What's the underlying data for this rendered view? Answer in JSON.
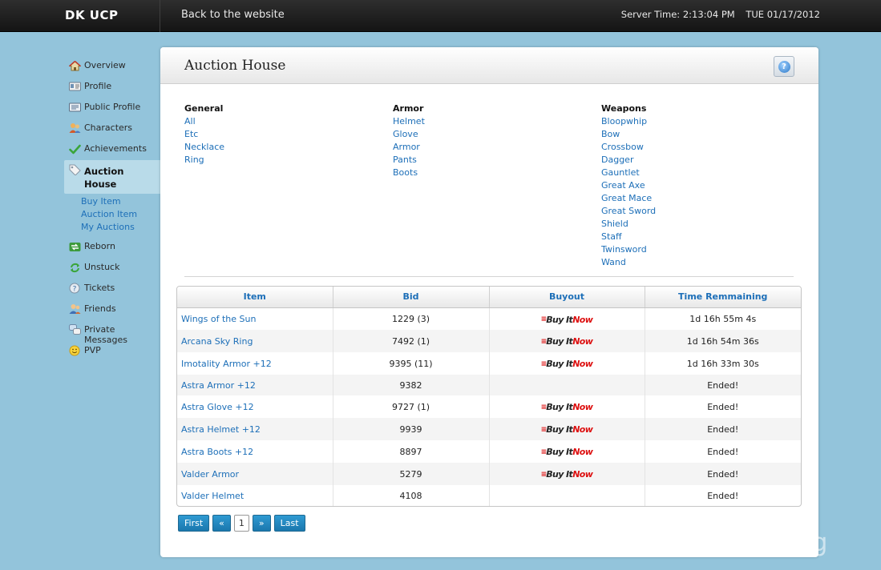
{
  "topbar": {
    "brand": "DK UCP",
    "back_link": "Back to the website",
    "server_time": "Server Time: 2:13:04 PM",
    "date": "TUE 01/17/2012"
  },
  "sidebar": {
    "items": [
      {
        "label": "Overview",
        "icon": "house-icon"
      },
      {
        "label": "Profile",
        "icon": "id-card-icon"
      },
      {
        "label": "Public Profile",
        "icon": "id-card-icon"
      },
      {
        "label": "Characters",
        "icon": "characters-icon"
      },
      {
        "label": "Achievements",
        "icon": "checkmark-icon"
      },
      {
        "label": "Auction House",
        "icon": "tag-icon"
      },
      {
        "label": "Reborn",
        "icon": "arrows-icon"
      },
      {
        "label": "Unstuck",
        "icon": "recycle-icon"
      },
      {
        "label": "Tickets",
        "icon": "help-circle-icon"
      },
      {
        "label": "Friends",
        "icon": "friends-icon"
      },
      {
        "label": "Private Messages",
        "icon": "chat-bubbles-icon"
      },
      {
        "label": "PVP",
        "icon": "smiley-icon"
      }
    ],
    "sub_items": [
      "Buy Item",
      "Auction Item",
      "My Auctions"
    ]
  },
  "panel": {
    "title": "Auction House",
    "help_label": "?"
  },
  "categories": {
    "general": {
      "heading": "General",
      "links": [
        "All",
        "Etc",
        "Necklace",
        "Ring"
      ]
    },
    "armor": {
      "heading": "Armor",
      "links": [
        "Helmet",
        "Glove",
        "Armor",
        "Pants",
        "Boots"
      ]
    },
    "weapons": {
      "heading": "Weapons",
      "links": [
        "Bloopwhip",
        "Bow",
        "Crossbow",
        "Dagger",
        "Gauntlet",
        "Great Axe",
        "Great Mace",
        "Great Sword",
        "Shield",
        "Staff",
        "Twinsword",
        "Wand"
      ]
    }
  },
  "table": {
    "headers": [
      "Item",
      "Bid",
      "Buyout",
      "Time Remmaining"
    ],
    "buy_now_part1": "Buy It",
    "buy_now_part2": "Now",
    "rows": [
      {
        "item": "Wings of the Sun",
        "bid": "1229 (3)",
        "buyout": true,
        "time": "1d 16h 55m 4s"
      },
      {
        "item": "Arcana Sky Ring",
        "bid": "7492 (1)",
        "buyout": true,
        "time": "1d 16h 54m 36s"
      },
      {
        "item": "Imotality Armor +12",
        "bid": "9395 (11)",
        "buyout": true,
        "time": "1d 16h 33m 30s"
      },
      {
        "item": "Astra Armor +12",
        "bid": "9382",
        "buyout": false,
        "time": "Ended!"
      },
      {
        "item": "Astra Glove +12",
        "bid": "9727 (1)",
        "buyout": true,
        "time": "Ended!"
      },
      {
        "item": "Astra Helmet +12",
        "bid": "9939",
        "buyout": true,
        "time": "Ended!"
      },
      {
        "item": "Astra Boots +12",
        "bid": "8897",
        "buyout": true,
        "time": "Ended!"
      },
      {
        "item": "Valder Armor",
        "bid": "5279",
        "buyout": true,
        "time": "Ended!"
      },
      {
        "item": "Valder Helmet",
        "bid": "4108",
        "buyout": false,
        "time": "Ended!"
      }
    ]
  },
  "pagination": {
    "first": "First",
    "prev": "«",
    "current": "1",
    "next": "»",
    "last": "Last"
  },
  "watermark": "www.dkunderground.org"
}
